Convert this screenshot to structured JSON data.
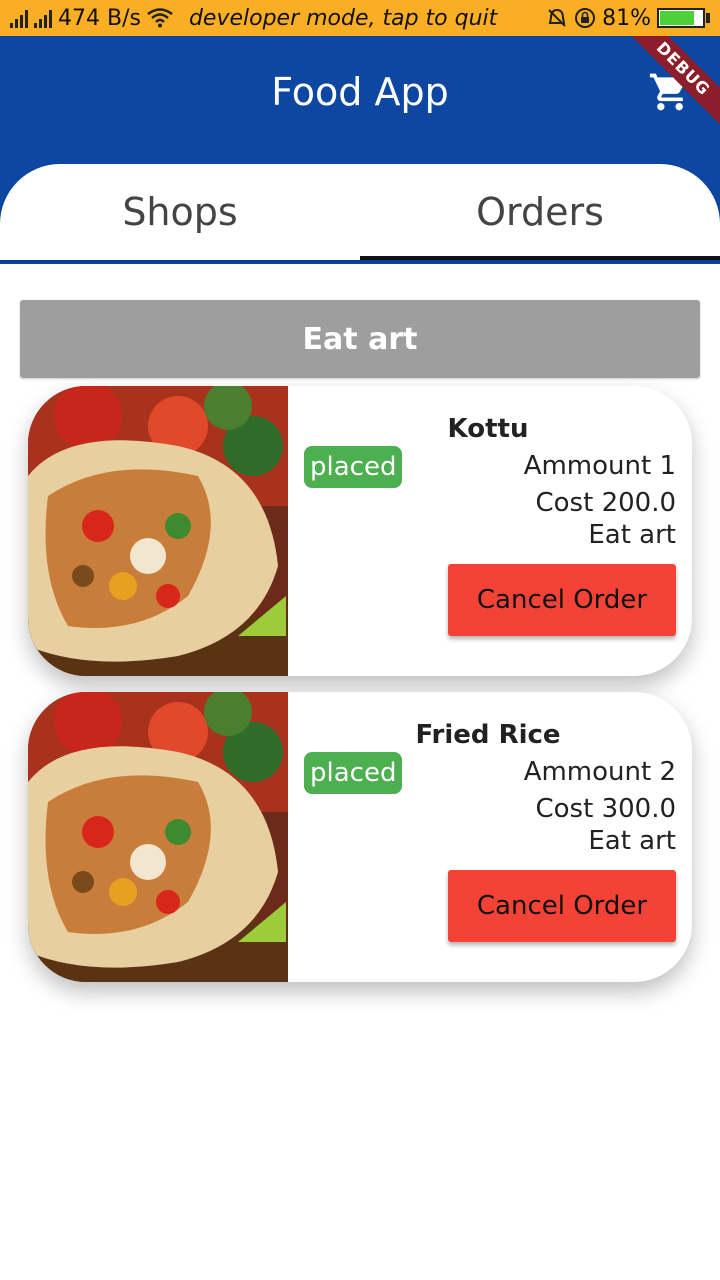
{
  "status_bar": {
    "speed": "474 B/s",
    "dev_mode": "developer mode, tap to quit",
    "battery_percent": "81%",
    "battery_level": 0.81
  },
  "app_bar": {
    "title": "Food App",
    "cart_icon": "cart-icon",
    "debug_banner": "DEBUG"
  },
  "tabs": [
    {
      "label": "Shops",
      "selected": false
    },
    {
      "label": "Orders",
      "selected": true
    }
  ],
  "shop": {
    "name": "Eat art"
  },
  "orders": [
    {
      "item": "Kottu",
      "status": "placed",
      "amount": "Ammount 1",
      "cost": "Cost 200.0",
      "shop": "Eat art",
      "cancel_label": "Cancel Order"
    },
    {
      "item": "Fried Rice",
      "status": "placed",
      "amount": "Ammount 2",
      "cost": "Cost 300.0",
      "shop": "Eat art",
      "cancel_label": "Cancel Order"
    }
  ],
  "colors": {
    "status_bar": "#F9AE23",
    "app_bar": "#0D47A1",
    "shop_header": "#9E9E9E",
    "status_chip": "#4CAF50",
    "cancel_button": "#F44336"
  }
}
